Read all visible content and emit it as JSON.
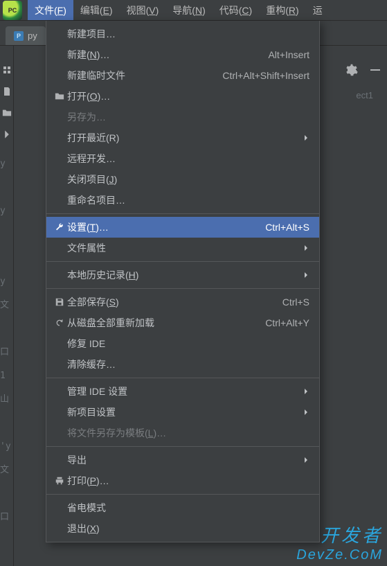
{
  "menubar": {
    "items": [
      {
        "label": "文件",
        "mn": "F",
        "active": true
      },
      {
        "label": "编辑",
        "mn": "E"
      },
      {
        "label": "视图",
        "mn": "V"
      },
      {
        "label": "导航",
        "mn": "N"
      },
      {
        "label": "代码",
        "mn": "C"
      },
      {
        "label": "重构",
        "mn": "R"
      },
      {
        "label": "运",
        "mn": ""
      }
    ]
  },
  "tab": {
    "prefix": "py"
  },
  "project_label": "ect1",
  "dropdown": {
    "items": [
      {
        "label": "新建项目…",
        "icon": ""
      },
      {
        "label": "新建",
        "mn": "N",
        "suffix": "…",
        "shortcut": "Alt+Insert"
      },
      {
        "label": "新建临时文件",
        "shortcut": "Ctrl+Alt+Shift+Insert"
      },
      {
        "label": "打开",
        "mn": "O",
        "suffix": "…",
        "icon": "folder"
      },
      {
        "label": "另存为…",
        "disabled": true
      },
      {
        "label": "打开最近",
        "mn_raw": "R",
        "submenu": true
      },
      {
        "label": "远程开发…"
      },
      {
        "label": "关闭项目",
        "mn": "J"
      },
      {
        "label": "重命名项目…"
      },
      {
        "sep": true
      },
      {
        "label": "设置",
        "mn": "T",
        "suffix": "…",
        "icon": "wrench",
        "shortcut": "Ctrl+Alt+S",
        "selected": true
      },
      {
        "label": "文件属性",
        "submenu": true
      },
      {
        "sep": true
      },
      {
        "label": "本地历史记录",
        "mn": "H",
        "submenu": true
      },
      {
        "sep": true
      },
      {
        "label": "全部保存",
        "mn": "S",
        "icon": "save",
        "shortcut": "Ctrl+S"
      },
      {
        "label": "从磁盘全部重新加载",
        "icon": "reload",
        "shortcut": "Ctrl+Alt+Y"
      },
      {
        "label": "修复 IDE"
      },
      {
        "label": "清除缓存…"
      },
      {
        "sep": true
      },
      {
        "label": "管理 IDE 设置",
        "submenu": true
      },
      {
        "label": "新项目设置",
        "submenu": true
      },
      {
        "label": "将文件另存为模板",
        "mn": "L",
        "suffix": "…",
        "disabled": true
      },
      {
        "sep": true
      },
      {
        "label": "导出",
        "submenu": true
      },
      {
        "label": "打印",
        "mn": "P",
        "suffix": "…",
        "icon": "print"
      },
      {
        "sep": true
      },
      {
        "label": "省电模式"
      },
      {
        "label": "退出",
        "mn": "X"
      }
    ]
  },
  "watermark": {
    "line1": "开发者",
    "line2": "DevZe.CoM"
  }
}
